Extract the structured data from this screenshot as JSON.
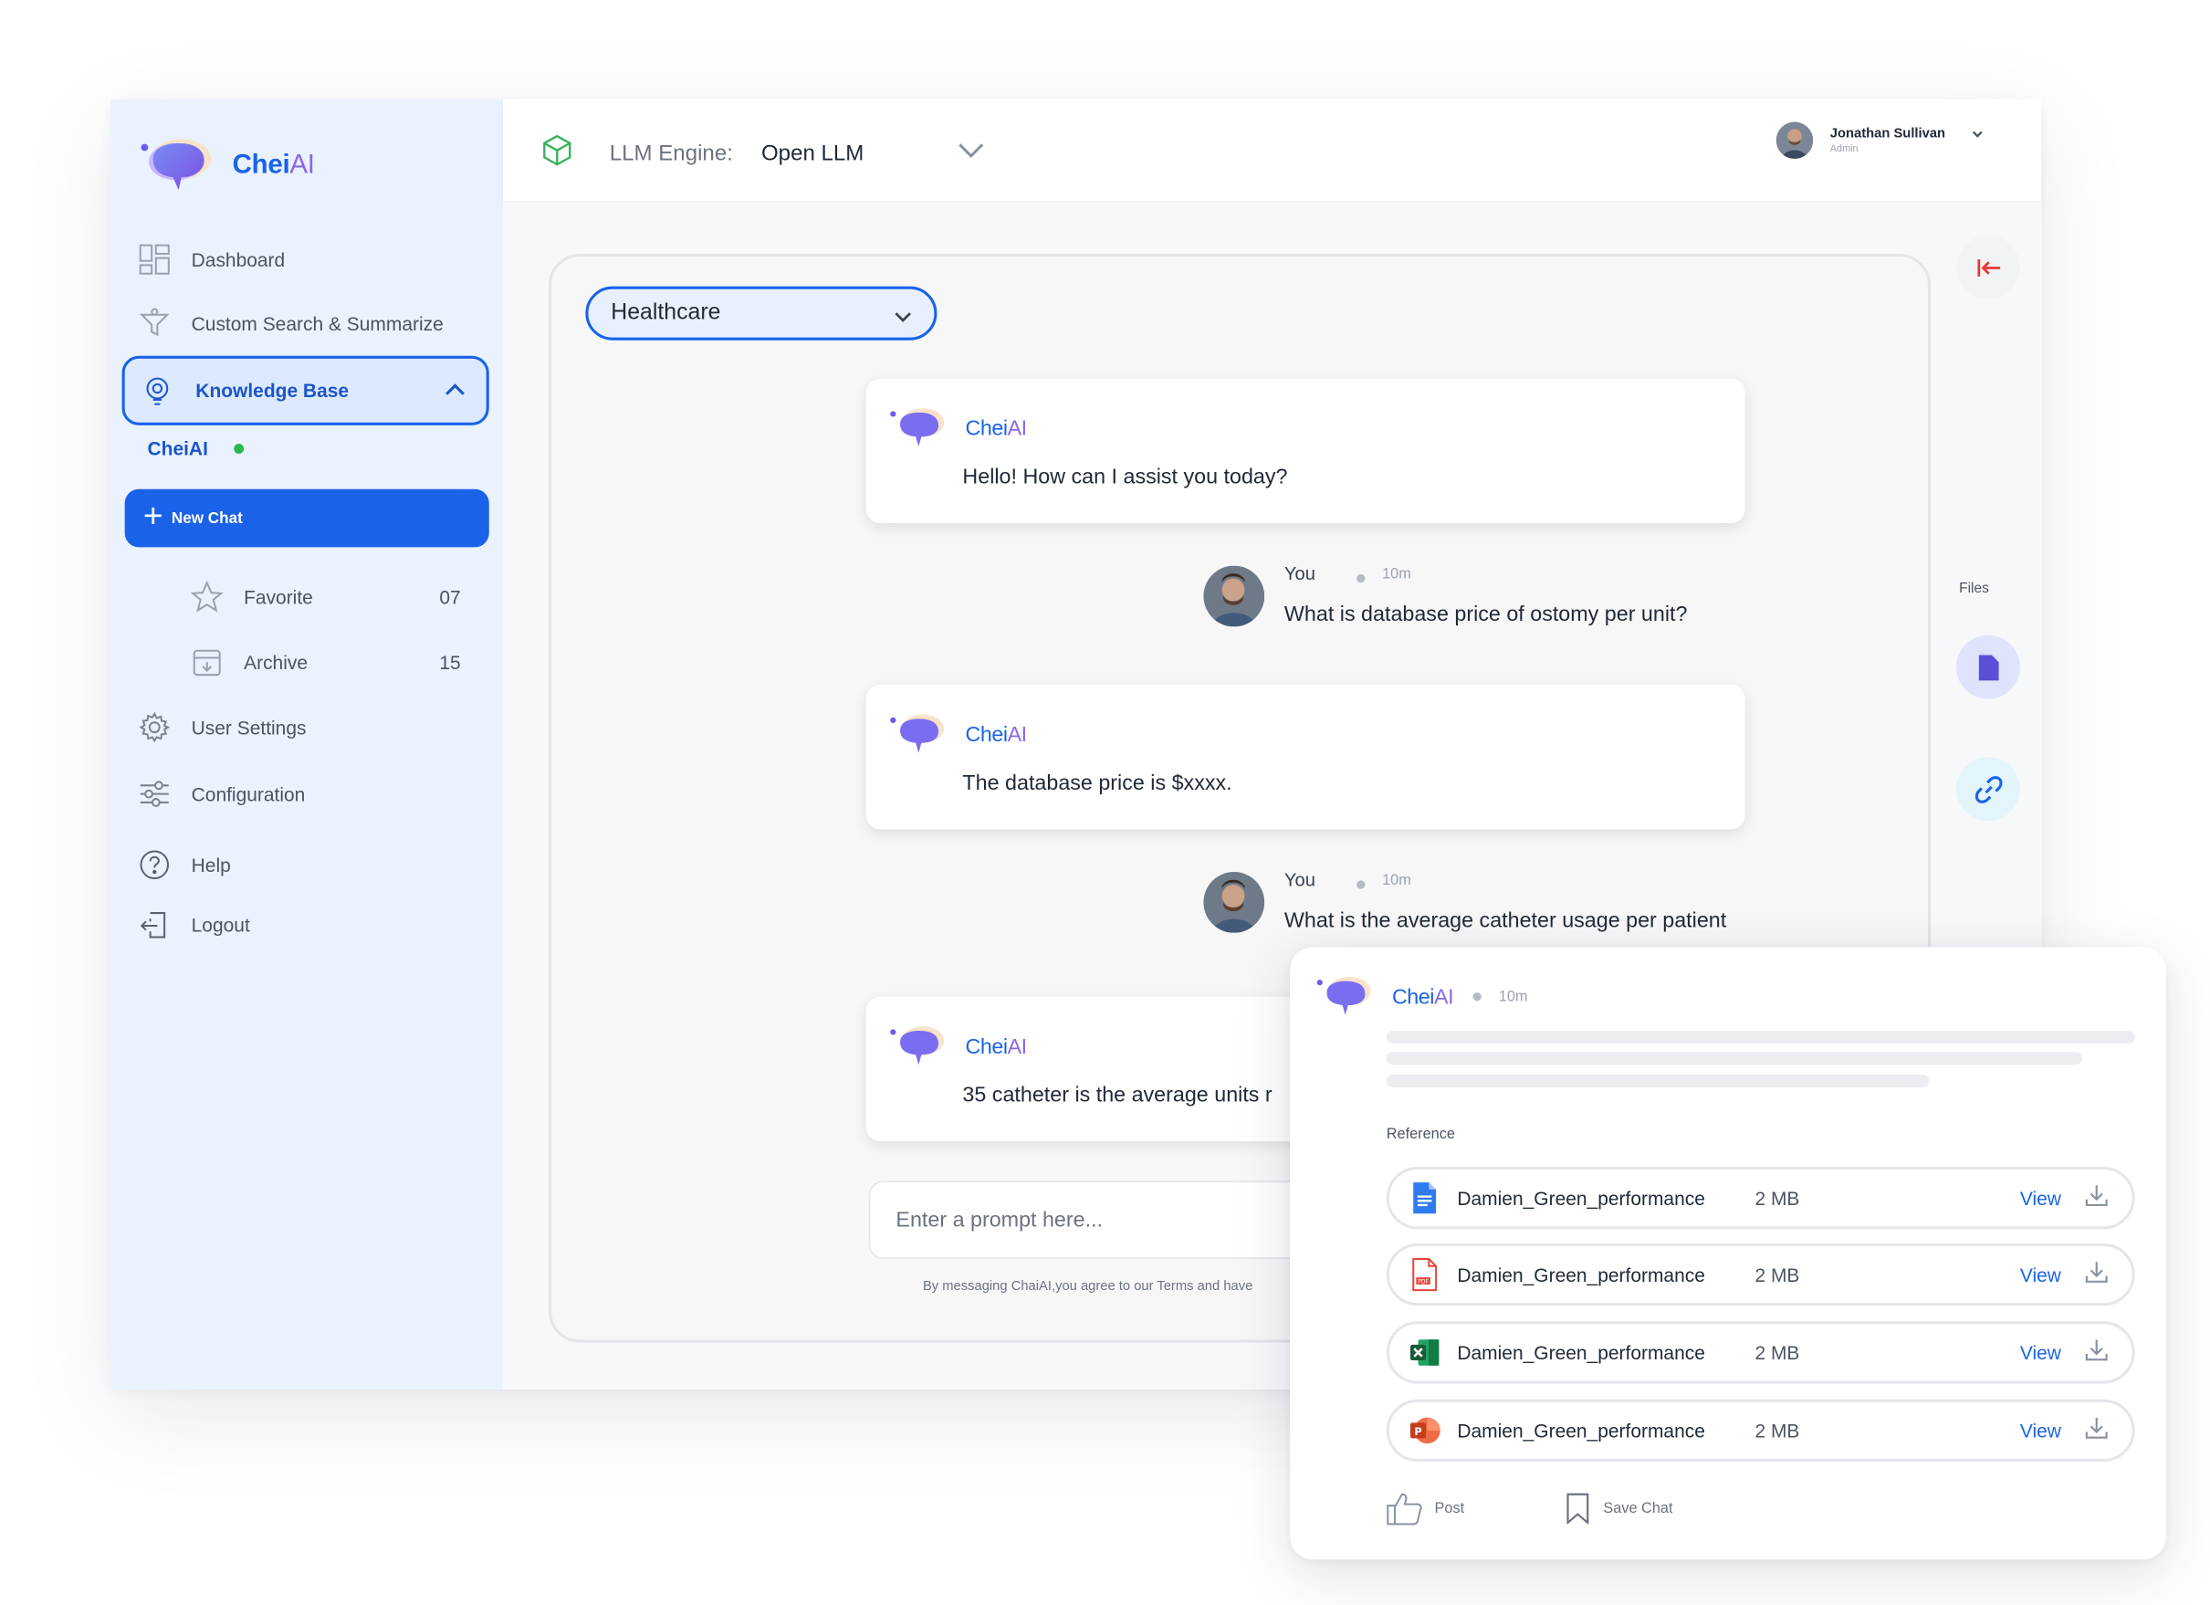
{
  "brand": {
    "name_main": "Chei",
    "name_ai": "AI"
  },
  "sidebar": {
    "items": [
      {
        "label": "Dashboard",
        "icon": "dashboard-icon"
      },
      {
        "label": "Custom Search & Summarize",
        "icon": "filter-icon"
      },
      {
        "label": "User Settings",
        "icon": "gear-icon"
      },
      {
        "label": "Configuration",
        "icon": "sliders-icon"
      },
      {
        "label": "Help",
        "icon": "help-icon"
      },
      {
        "label": "Logout",
        "icon": "logout-icon"
      }
    ],
    "knowledge_base": {
      "label": "Knowledge Base",
      "icon": "lightbulb-icon",
      "expanded": true,
      "sub_label": "CheiAI"
    },
    "new_chat": "New Chat",
    "favorite": {
      "label": "Favorite",
      "count": "07"
    },
    "archive": {
      "label": "Archive",
      "count": "15"
    }
  },
  "header": {
    "engine_label": "LLM Engine:",
    "engine_value": "Open LLM",
    "user_name": "Jonathan Sullivan",
    "user_role": "Admin"
  },
  "chat": {
    "domain": "Healthcare",
    "messages": [
      {
        "from": "bot",
        "text": "Hello! How can I assist you today?"
      },
      {
        "from": "you",
        "name": "You",
        "time": "10m",
        "text": "What is database price of ostomy per unit?"
      },
      {
        "from": "bot",
        "text": "The database price is $xxxx."
      },
      {
        "from": "you",
        "name": "You",
        "time": "10m",
        "text": "What is the average catheter usage per patient"
      },
      {
        "from": "bot",
        "text": "35 catheter is the average units r"
      }
    ],
    "prompt_placeholder": "Enter a prompt here...",
    "disclaimer": "By messaging ChaiAI,you agree to our Terms and have"
  },
  "rail": {
    "files_label": "Files"
  },
  "reference_card": {
    "time": "10m",
    "reference_label": "Reference",
    "files": [
      {
        "name": "Damien_Green_performance",
        "size": "2 MB",
        "type": "doc",
        "view": "View"
      },
      {
        "name": "Damien_Green_performance",
        "size": "2 MB",
        "type": "pdf",
        "view": "View"
      },
      {
        "name": "Damien_Green_performance",
        "size": "2 MB",
        "type": "excel",
        "view": "View"
      },
      {
        "name": "Damien_Green_performance",
        "size": "2 MB",
        "type": "ppt",
        "view": "View"
      }
    ],
    "post_label": "Post",
    "save_label": "Save Chat"
  },
  "colors": {
    "accent": "#1a63e8",
    "sidebar_bg": "#eaf2ff",
    "ai_purple": "#8a67e8",
    "online": "#2bb84c"
  }
}
